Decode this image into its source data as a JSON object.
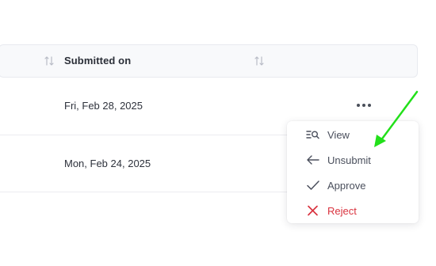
{
  "table": {
    "columns": [
      {
        "label": "Submitted on",
        "sortable": true
      }
    ],
    "rows": [
      {
        "submitted_on": "Fri, Feb 28, 2025"
      },
      {
        "submitted_on": "Mon, Feb 24, 2025"
      }
    ]
  },
  "row_actions": {
    "icon": "more-horizontal-icon",
    "menu": [
      {
        "label": "View",
        "icon": "view-list-search-icon"
      },
      {
        "label": "Unsubmit",
        "icon": "arrow-left-icon"
      },
      {
        "label": "Approve",
        "icon": "check-icon"
      },
      {
        "label": "Reject",
        "icon": "x-icon",
        "color": "#d9333f"
      }
    ]
  },
  "annotation": {
    "color": "#22e01a"
  },
  "colors": {
    "header_bg": "#f8f9fb",
    "danger": "#d9333f",
    "text": "#2e323c"
  }
}
